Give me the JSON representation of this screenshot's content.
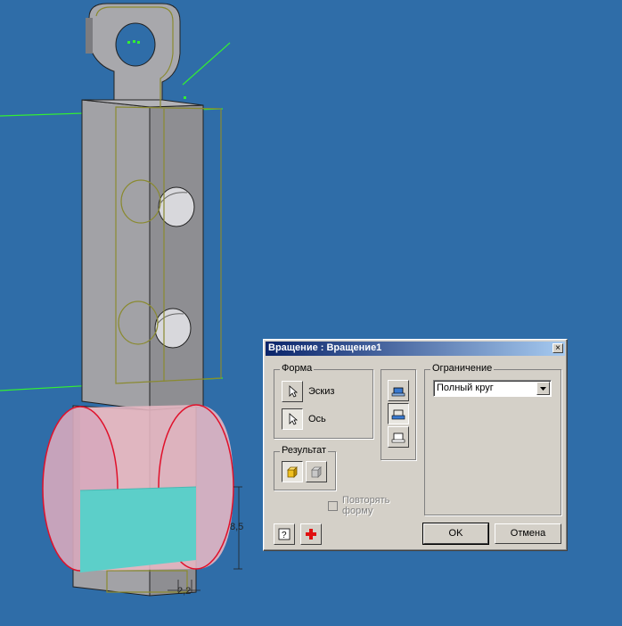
{
  "dialog": {
    "title": "Вращение : Вращение1",
    "close_glyph": "×",
    "shape_group": {
      "label": "Форма",
      "sketch_label": "Эскиз",
      "axis_label": "Ось"
    },
    "result_group": {
      "label": "Результат"
    },
    "repeat_shape_label_line1": "Повторять",
    "repeat_shape_label_line2": "форму",
    "limit_group": {
      "label": "Ограничение",
      "selected": "Полный круг"
    },
    "ok_label": "OK",
    "cancel_label": "Отмена"
  },
  "viewport": {
    "dimension_1": "8,5",
    "dimension_2": "2,2"
  },
  "colors": {
    "background": "#2f6da8",
    "part_gray": "#9a9a9e",
    "sketch_green": "#00ff00",
    "revolve_preview": "#e8b8c4",
    "profile_cyan": "#5ccfc9"
  },
  "icons": [
    "cursor-arrow-icon",
    "solid-cube-icon",
    "surface-cube-icon",
    "help-icon",
    "add-plus-icon",
    "extents-icon",
    "dropdown-arrow-icon"
  ]
}
